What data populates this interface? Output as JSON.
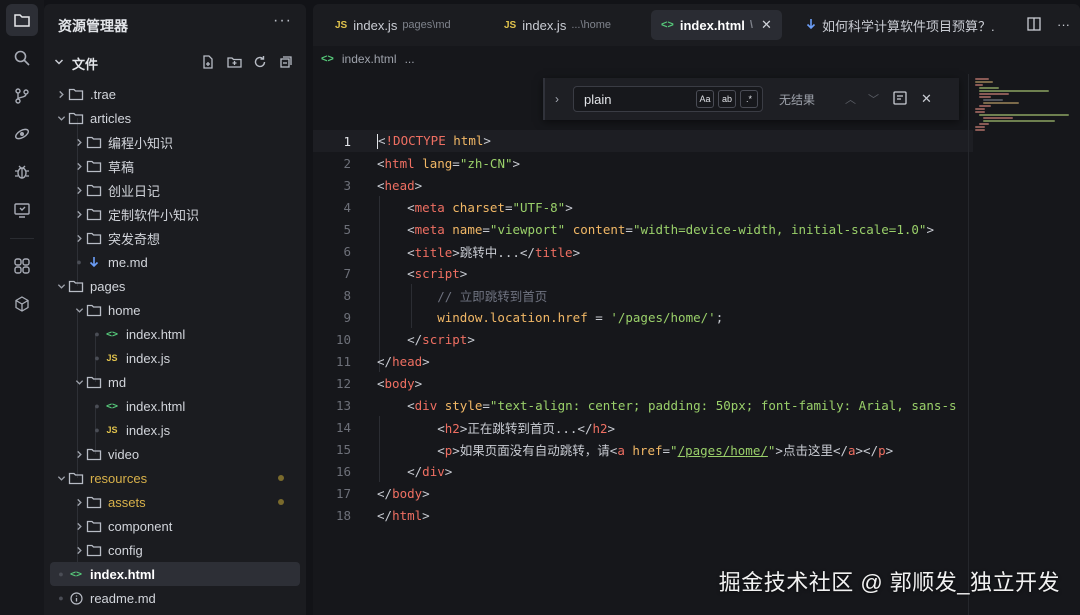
{
  "sidebar": {
    "title": "资源管理器",
    "more": "···",
    "section_label": "文件",
    "tree": [
      {
        "label": ".trae",
        "kind": "folder",
        "depth": 0,
        "open": false
      },
      {
        "label": "articles",
        "kind": "folder",
        "depth": 0,
        "open": true
      },
      {
        "label": "编程小知识",
        "kind": "folder",
        "depth": 1,
        "open": false
      },
      {
        "label": "草稿",
        "kind": "folder",
        "depth": 1,
        "open": false
      },
      {
        "label": "创业日记",
        "kind": "folder",
        "depth": 1,
        "open": false
      },
      {
        "label": "定制软件小知识",
        "kind": "folder",
        "depth": 1,
        "open": false
      },
      {
        "label": "突发奇想",
        "kind": "folder",
        "depth": 1,
        "open": false
      },
      {
        "label": "me.md",
        "kind": "md",
        "depth": 1
      },
      {
        "label": "pages",
        "kind": "folder",
        "depth": 0,
        "open": true
      },
      {
        "label": "home",
        "kind": "folder",
        "depth": 1,
        "open": true
      },
      {
        "label": "index.html",
        "kind": "html",
        "depth": 2
      },
      {
        "label": "index.js",
        "kind": "js",
        "depth": 2
      },
      {
        "label": "md",
        "kind": "folder",
        "depth": 1,
        "open": true
      },
      {
        "label": "index.html",
        "kind": "html",
        "depth": 2
      },
      {
        "label": "index.js",
        "kind": "js",
        "depth": 2
      },
      {
        "label": "video",
        "kind": "folder",
        "depth": 1,
        "open": false
      },
      {
        "label": "resources",
        "kind": "folder",
        "depth": 0,
        "open": true,
        "modified": true
      },
      {
        "label": "assets",
        "kind": "folder",
        "depth": 1,
        "open": false,
        "modified": true
      },
      {
        "label": "component",
        "kind": "folder",
        "depth": 1,
        "open": false
      },
      {
        "label": "config",
        "kind": "folder",
        "depth": 1,
        "open": false
      },
      {
        "label": "index.html",
        "kind": "html",
        "depth": 0,
        "selected": true
      },
      {
        "label": "readme.md",
        "kind": "info",
        "depth": 0
      }
    ]
  },
  "tabs": [
    {
      "label": "index.js",
      "path": "pages\\md",
      "kind": "js"
    },
    {
      "label": "index.js",
      "path": "...\\home",
      "kind": "js"
    },
    {
      "label": "index.html",
      "path": "\\",
      "kind": "html",
      "active": true
    },
    {
      "label": "如何科学计算软件项目预算？.",
      "kind": "md"
    }
  ],
  "breadcrumb": {
    "file": "index.html",
    "rest": "..."
  },
  "find": {
    "query": "plain",
    "opt_case": "Aa",
    "opt_word": "ab",
    "opt_regex": ".*",
    "result": "无结果"
  },
  "code": {
    "line_numbers": [
      "1",
      "2",
      "3",
      "4",
      "5",
      "6",
      "7",
      "8",
      "9",
      "10",
      "11",
      "12",
      "13",
      "14",
      "15",
      "16",
      "17",
      "18"
    ],
    "current_line": 1
  },
  "watermark": "掘金技术社区 @ 郭顺发_独立开发",
  "colors": {
    "tag": "#ef6f62",
    "attr": "#f2b866",
    "string": "#9ad06a",
    "comment": "#6f7380",
    "modified": "#d8b14a"
  }
}
